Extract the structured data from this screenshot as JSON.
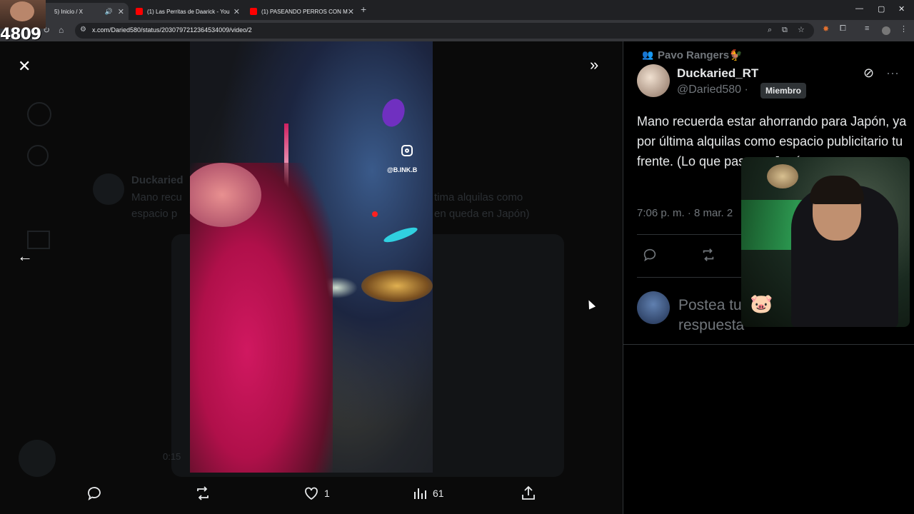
{
  "browser": {
    "tabs": [
      {
        "title": "5) Inicio / X",
        "favicon_color": "#1d1d1d"
      },
      {
        "title": "(1) Las Perritas de Daarick - You",
        "favicon_color": "#ff0000"
      },
      {
        "title": "(1) PASEANDO PERROS CON M",
        "favicon_color": "#ff0000"
      }
    ],
    "url": "x.com/Daried580/status/2030797212364534009/video/2"
  },
  "overlay": {
    "streamer_number": "4809"
  },
  "video": {
    "instagram_handle": "@B.INK.B"
  },
  "media_actions": {
    "like_count": "1",
    "views_count": "61"
  },
  "tweet": {
    "social_context": "Pavo Rangers🐓",
    "display_name": "Duckaried_RT",
    "handle": "@Daried580 ·",
    "badge": "Miembro",
    "text": "Mano recuerda estar ahorrando para Japón, ya por última alquilas como espacio publicitario tu frente. (Lo que pasa en Japón se",
    "timestamp": "7:06 p. m. · 8 mar. 2",
    "reply_placeholder": "Postea tu respuesta"
  },
  "background_ghost": {
    "name": "Duckaried",
    "line1": "Mano recu",
    "line2": "espacio p",
    "line3": "tima alquilas como",
    "line4": "en queda en Japón)",
    "time": "0:15"
  }
}
